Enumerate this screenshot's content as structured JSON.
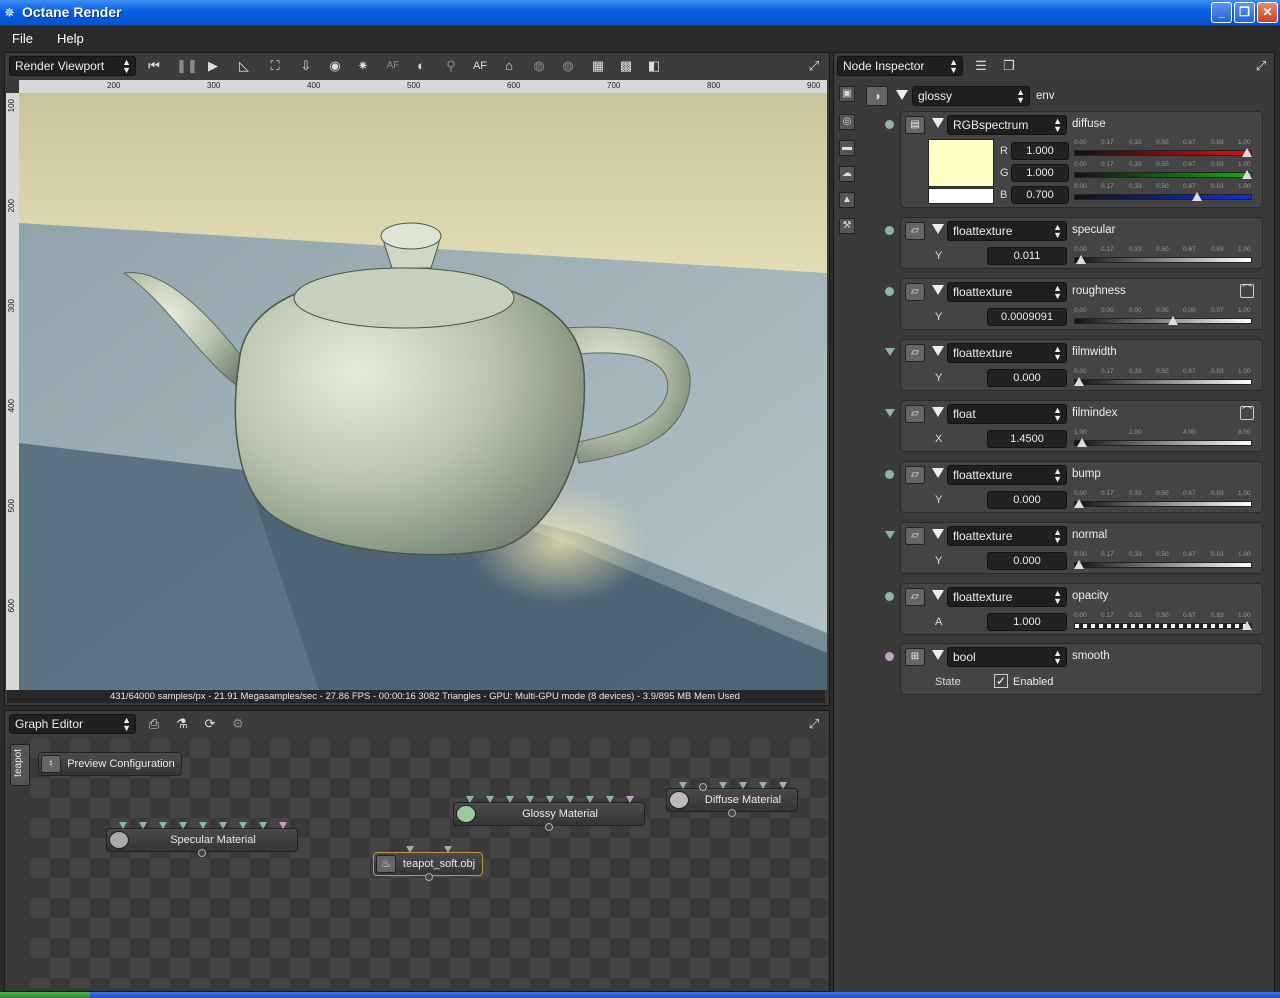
{
  "window": {
    "title": "Octane Render",
    "min": "_",
    "max": "❐",
    "close": "✕"
  },
  "menu": {
    "file": "File",
    "help": "Help"
  },
  "viewport": {
    "mode": "Render Viewport",
    "ruler_h": [
      "200",
      "300",
      "400",
      "500",
      "600",
      "700",
      "800",
      "900"
    ],
    "ruler_v": [
      "100",
      "200",
      "300",
      "400",
      "500",
      "600"
    ],
    "status": "431/64000 samples/px - 21.91 Megasamples/sec - 27.86 FPS - 00:00:16    3082 Triangles - GPU: Multi-GPU mode (8 devices) - 3.9/895 MB Mem Used",
    "af_label": "AF"
  },
  "graph": {
    "mode": "Graph Editor",
    "tab": "teapot",
    "nodes": {
      "preview": "Preview Configuration",
      "specular": "Specular Material",
      "glossy": "Glossy Material",
      "diffuse": "Diffuse Material",
      "teapot": "teapot_soft.obj"
    }
  },
  "inspector": {
    "mode": "Node Inspector",
    "root": {
      "type": "glossy",
      "name": "env"
    },
    "diffuse": {
      "type": "RGBspectrum",
      "name": "diffuse",
      "r_label": "R",
      "g_label": "G",
      "b_label": "B",
      "r": "1.000",
      "g": "1.000",
      "b": "0.700",
      "r_level": 1.0,
      "g_level": 1.0,
      "b_level": 0.7,
      "swatch_color": "#fffdc4"
    },
    "ticks": [
      "0.00",
      "0.17",
      "0.33",
      "0.50",
      "0.67",
      "0.83",
      "1.00"
    ],
    "rough_ticks": [
      "0.00",
      "0.00",
      "0.00",
      "0.00",
      "0.00",
      "0.07",
      "1.00"
    ],
    "film_ticks": [
      "1.00",
      "2.00",
      "4.00",
      "8.00"
    ],
    "specular": {
      "type": "floattexture",
      "name": "specular",
      "axis": "Y",
      "value": "0.011",
      "level": 0.011
    },
    "roughness": {
      "type": "floattexture",
      "name": "roughness",
      "axis": "Y",
      "value": "0.0009091",
      "level": 0.56
    },
    "filmwidth": {
      "type": "floattexture",
      "name": "filmwidth",
      "axis": "Y",
      "value": "0.000",
      "level": 0.0
    },
    "filmindex": {
      "type": "float",
      "name": "filmindex",
      "axis": "X",
      "value": "1.4500",
      "level": 0.02
    },
    "bump": {
      "type": "floattexture",
      "name": "bump",
      "axis": "Y",
      "value": "0.000",
      "level": 0.0
    },
    "normal": {
      "type": "floattexture",
      "name": "normal",
      "axis": "Y",
      "value": "0.000",
      "level": 0.0
    },
    "opacity": {
      "type": "floattexture",
      "name": "opacity",
      "axis": "A",
      "value": "1.000",
      "level": 1.0
    },
    "smooth": {
      "type": "bool",
      "name": "smooth",
      "axis": "State",
      "value": "Enabled",
      "checked": true
    }
  },
  "colors": {
    "accent_red": "#d01010",
    "accent_green": "#10a010",
    "accent_blue": "#1030d0",
    "titlebar": "#0a5fe0"
  }
}
